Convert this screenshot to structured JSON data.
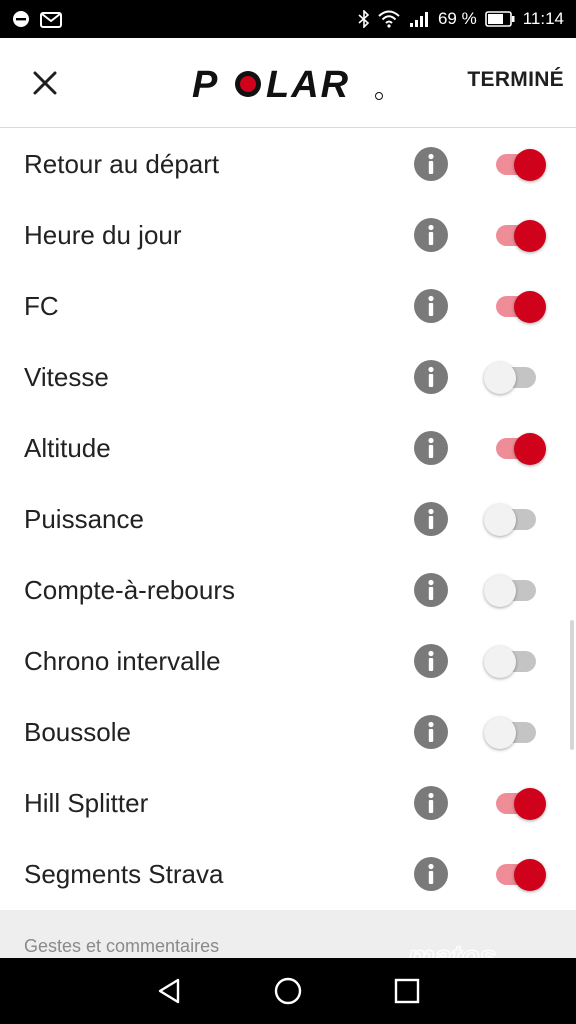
{
  "status_bar": {
    "battery": "69 %",
    "time": "11:14",
    "icons": [
      "circle-status-icon",
      "mail-icon",
      "bluetooth-icon",
      "wifi-icon",
      "signal-icon",
      "battery-icon"
    ]
  },
  "header": {
    "brand": "POLAR",
    "done_label": "TERMINÉ",
    "close_icon": "close-icon"
  },
  "colors": {
    "accent": "#d0021b",
    "accent_track": "#ee8d97",
    "off_track": "#c4c4c4",
    "info_icon": "#7a7a7a"
  },
  "items": [
    {
      "label": "Retour au départ",
      "enabled": true
    },
    {
      "label": "Heure du jour",
      "enabled": true
    },
    {
      "label": "FC",
      "enabled": true
    },
    {
      "label": "Vitesse",
      "enabled": false
    },
    {
      "label": "Altitude",
      "enabled": true
    },
    {
      "label": "Puissance",
      "enabled": false
    },
    {
      "label": "Compte-à-rebours",
      "enabled": false
    },
    {
      "label": "Chrono intervalle",
      "enabled": false
    },
    {
      "label": "Boussole",
      "enabled": false
    },
    {
      "label": "Hill Splitter",
      "enabled": true
    },
    {
      "label": "Segments Strava",
      "enabled": true
    }
  ],
  "section": {
    "label": "Gestes et commentaires"
  },
  "watermark": {
    "text": "matos vélo"
  },
  "nav_bar": {
    "icons": [
      "back-icon",
      "home-icon",
      "recents-icon"
    ]
  }
}
